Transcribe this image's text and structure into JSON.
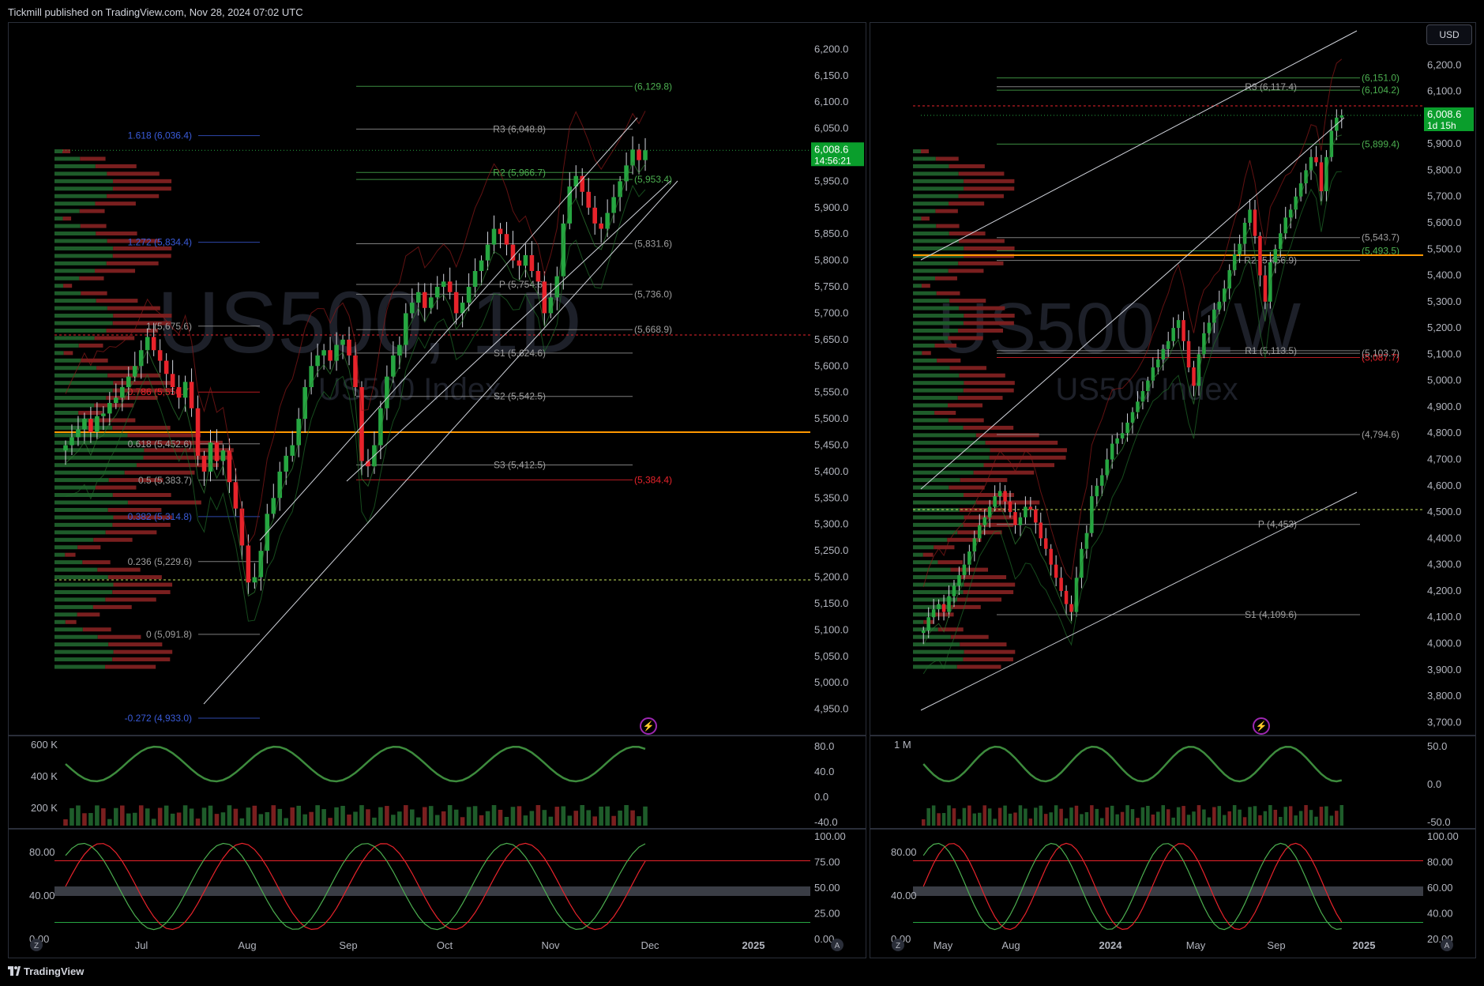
{
  "header": {
    "published": "Tickmill published on TradingView.com, Nov 28, 2024 07:02 UTC"
  },
  "footer": {
    "brand": "TradingView"
  },
  "currency_button": "USD",
  "colors": {
    "up": "#26a641",
    "down": "#e8232b",
    "pivot_line": "#9e9e9e",
    "fib_blue": "#3a5bd9",
    "orange": "#ff9800",
    "green_line": "#4caf50",
    "bg": "#000000"
  },
  "chart_data": [
    {
      "type": "candlestick",
      "panel": "left",
      "symbol_watermark": "US500, 1D",
      "watermark_sub": "US500 Index",
      "ylim": [
        4900,
        6220
      ],
      "y_ticks": [
        "6,200.0",
        "6,150.0",
        "6,100.0",
        "6,050.0",
        "6,000.0",
        "5,950.0",
        "5,900.0",
        "5,850.0",
        "5,800.0",
        "5,750.0",
        "5,700.0",
        "5,650.0",
        "5,600.0",
        "5,550.0",
        "5,500.0",
        "5,450.0",
        "5,400.0",
        "5,350.0",
        "5,300.0",
        "5,250.0",
        "5,200.0",
        "5,150.0",
        "5,100.0",
        "5,050.0",
        "5,000.0",
        "4,950.0"
      ],
      "y_tick_values": [
        6200,
        6150,
        6100,
        6050,
        6000,
        5950,
        5900,
        5850,
        5800,
        5750,
        5700,
        5650,
        5600,
        5550,
        5500,
        5450,
        5400,
        5350,
        5300,
        5250,
        5200,
        5150,
        5100,
        5050,
        5000,
        4950
      ],
      "x_ticks": [
        "Jul",
        "Aug",
        "Sep",
        "Oct",
        "Nov",
        "Dec",
        "2025"
      ],
      "price_label": {
        "value": "6,008.6",
        "countdown": "14:56:21"
      },
      "fib_labels": [
        {
          "text": "1.618 (6,036.4)",
          "value": 6036.4,
          "color": "#3a5bd9"
        },
        {
          "text": "1.272 (5,834.4)",
          "value": 5834.4,
          "color": "#3a5bd9"
        },
        {
          "text": "1 (5,675.6)",
          "value": 5675.6,
          "color": "#9e9e9e"
        },
        {
          "text": "0.786 (5,550.7)",
          "value": 5550.7,
          "color": "#e8232b"
        },
        {
          "text": "0.618 (5,452.6)",
          "value": 5452.6,
          "color": "#9e9e9e"
        },
        {
          "text": "0.5 (5,383.7)",
          "value": 5383.7,
          "color": "#9e9e9e"
        },
        {
          "text": "0.382 (5,314.8)",
          "value": 5314.8,
          "color": "#3a5bd9"
        },
        {
          "text": "0.236 (5,229.6)",
          "value": 5229.6,
          "color": "#9e9e9e"
        },
        {
          "text": "0 (5,091.8)",
          "value": 5091.8,
          "color": "#9e9e9e"
        },
        {
          "text": "-0.272 (4,933.0)",
          "value": 4933.0,
          "color": "#3a5bd9"
        }
      ],
      "pivot_labels": [
        {
          "text": "(6,129.8)",
          "value": 6129.8,
          "color": "#4caf50"
        },
        {
          "text": "R3 (6,048.8)",
          "value": 6048.8,
          "color": "#9e9e9e"
        },
        {
          "text": "R2 (5,966.7)",
          "value": 5966.7,
          "color": "#4caf50"
        },
        {
          "text": "(5,953.4)",
          "value": 5953.4,
          "color": "#4caf50"
        },
        {
          "text": "(5,831.6)",
          "value": 5831.6,
          "color": "#9e9e9e"
        },
        {
          "text": "P (5,754.6)",
          "value": 5754.6,
          "color": "#9e9e9e"
        },
        {
          "text": "(5,736.0)",
          "value": 5736.0,
          "color": "#9e9e9e"
        },
        {
          "text": "(5,668.9)",
          "value": 5668.9,
          "color": "#9e9e9e"
        },
        {
          "text": "S1 (5,624.6)",
          "value": 5624.6,
          "color": "#9e9e9e"
        },
        {
          "text": "S2 (5,542.5)",
          "value": 5542.5,
          "color": "#9e9e9e"
        },
        {
          "text": "S3 (5,412.5)",
          "value": 5412.5,
          "color": "#9e9e9e"
        },
        {
          "text": "(5,384.4)",
          "value": 5384.4,
          "color": "#e8232b"
        }
      ],
      "volume_axis": [
        "600 K",
        "400 K",
        "200 K"
      ],
      "osc_axis": [
        "80.0",
        "40.0",
        "0.0",
        "-40.0"
      ],
      "stoch_axis_left": [
        "80.00",
        "40.00",
        "0.00"
      ],
      "stoch_axis_right": [
        "100.00",
        "75.00",
        "50.00",
        "25.00",
        "0.00"
      ],
      "closes": [
        5450,
        5465,
        5480,
        5500,
        5475,
        5505,
        5510,
        5530,
        5540,
        5560,
        5580,
        5600,
        5630,
        5655,
        5630,
        5610,
        5585,
        5560,
        5540,
        5570,
        5520,
        5430,
        5400,
        5455,
        5420,
        5440,
        5380,
        5330,
        5260,
        5190,
        5200,
        5250,
        5320,
        5350,
        5400,
        5430,
        5450,
        5500,
        5560,
        5600,
        5620,
        5630,
        5610,
        5640,
        5650,
        5620,
        5560,
        5420,
        5410,
        5450,
        5520,
        5580,
        5620,
        5640,
        5700,
        5720,
        5740,
        5710,
        5730,
        5750,
        5760,
        5740,
        5700,
        5720,
        5750,
        5780,
        5800,
        5830,
        5860,
        5850,
        5830,
        5800,
        5790,
        5810,
        5780,
        5760,
        5700,
        5730,
        5770,
        5870,
        5940,
        5960,
        5930,
        5900,
        5870,
        5860,
        5890,
        5920,
        5950,
        5980,
        6010,
        5990,
        6008.6
      ]
    },
    {
      "type": "candlestick",
      "panel": "right",
      "symbol_watermark": "US500, 1W",
      "watermark_sub": "US500 Index",
      "ylim": [
        3650,
        6300
      ],
      "y_ticks": [
        "6,200.0",
        "6,100.0",
        "6,000.0",
        "5,900.0",
        "5,800.0",
        "5,700.0",
        "5,600.0",
        "5,500.0",
        "5,400.0",
        "5,300.0",
        "5,200.0",
        "5,100.0",
        "5,000.0",
        "4,900.0",
        "4,800.0",
        "4,700.0",
        "4,600.0",
        "4,500.0",
        "4,400.0",
        "4,300.0",
        "4,200.0",
        "4,100.0",
        "4,000.0",
        "3,900.0",
        "3,800.0",
        "3,700.0"
      ],
      "y_tick_values": [
        6200,
        6100,
        6000,
        5900,
        5800,
        5700,
        5600,
        5500,
        5400,
        5300,
        5200,
        5100,
        5000,
        4900,
        4800,
        4700,
        4600,
        4500,
        4400,
        4300,
        4200,
        4100,
        4000,
        3900,
        3800,
        3700
      ],
      "x_ticks": [
        "May",
        "Aug",
        "2024",
        "May",
        "Sep",
        "2025"
      ],
      "price_label": {
        "value": "6,008.6",
        "countdown": "1d 15h"
      },
      "pivot_labels": [
        {
          "text": "(6,151.0)",
          "value": 6151.0,
          "color": "#4caf50"
        },
        {
          "text": "R3 (6,117.4)",
          "value": 6117.4,
          "color": "#9e9e9e"
        },
        {
          "text": "(6,104.2)",
          "value": 6104.2,
          "color": "#4caf50"
        },
        {
          "text": "(5,899.4)",
          "value": 5899.4,
          "color": "#4caf50"
        },
        {
          "text": "(5,543.7)",
          "value": 5543.7,
          "color": "#9e9e9e"
        },
        {
          "text": "(5,493.5)",
          "value": 5493.5,
          "color": "#4caf50"
        },
        {
          "text": "R2 (5,456.9)",
          "value": 5456.9,
          "color": "#9e9e9e"
        },
        {
          "text": "R1 (5,113.5)",
          "value": 5113.5,
          "color": "#9e9e9e"
        },
        {
          "text": "(5,087.7)",
          "value": 5087.7,
          "color": "#e8232b"
        },
        {
          "text": "(5,103.7)",
          "value": 5103.7,
          "color": "#9e9e9e"
        },
        {
          "text": "(4,794.6)",
          "value": 4794.6,
          "color": "#9e9e9e"
        },
        {
          "text": "P (4,453)",
          "value": 4453,
          "color": "#9e9e9e"
        },
        {
          "text": "S1 (4,109.6)",
          "value": 4109.6,
          "color": "#9e9e9e"
        }
      ],
      "volume_axis": [
        "1 M"
      ],
      "osc_axis": [
        "50.0",
        "0.0",
        "-50.0"
      ],
      "stoch_axis_left": [
        "80.00",
        "40.00",
        "0.00"
      ],
      "stoch_axis_right": [
        "100.00",
        "80.00",
        "60.00",
        "40.00",
        "20.00"
      ],
      "closes": [
        4050,
        4100,
        4130,
        4150,
        4120,
        4180,
        4220,
        4260,
        4300,
        4350,
        4400,
        4450,
        4480,
        4520,
        4560,
        4580,
        4540,
        4500,
        4450,
        4480,
        4520,
        4510,
        4460,
        4400,
        4360,
        4300,
        4250,
        4200,
        4150,
        4120,
        4250,
        4360,
        4420,
        4560,
        4600,
        4640,
        4700,
        4760,
        4780,
        4800,
        4840,
        4880,
        4920,
        4960,
        5000,
        5050,
        5080,
        5120,
        5150,
        5200,
        5230,
        5150,
        5050,
        4980,
        5100,
        5180,
        5220,
        5270,
        5300,
        5350,
        5420,
        5480,
        5520,
        5600,
        5650,
        5550,
        5400,
        5300,
        5450,
        5500,
        5560,
        5620,
        5650,
        5700,
        5750,
        5800,
        5850,
        5830,
        5720,
        5850,
        5950,
        6000,
        6008.6
      ]
    }
  ]
}
